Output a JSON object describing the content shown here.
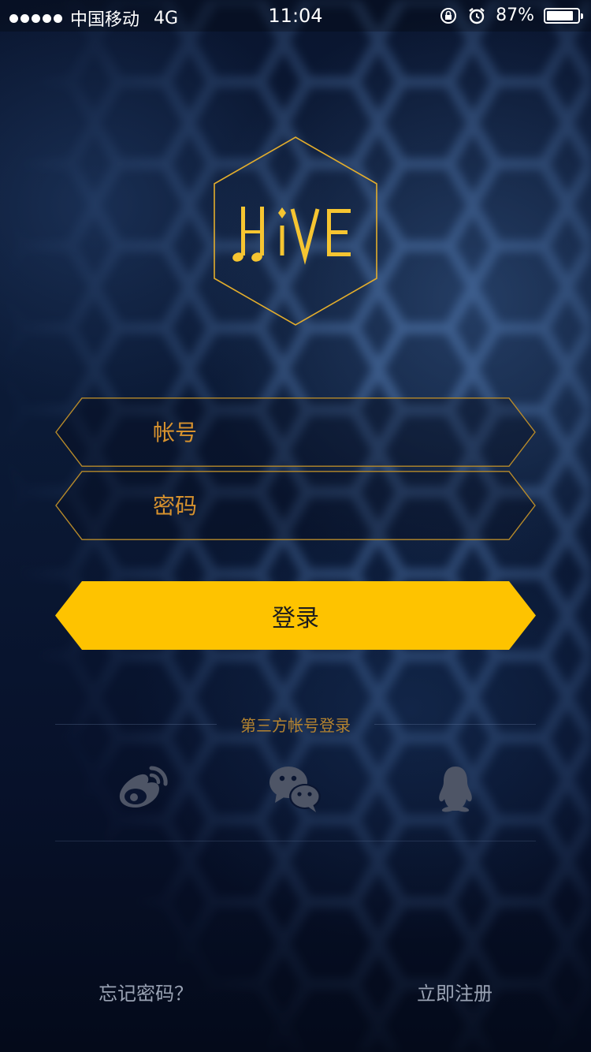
{
  "status_bar": {
    "carrier": "中国移动",
    "network": "4G",
    "time": "11:04",
    "battery_percent": "87%",
    "battery_level": 0.87
  },
  "logo": {
    "text_h": "H",
    "text_i": "i",
    "text_ve": "VE",
    "color": "#f6c531"
  },
  "login_form": {
    "account_placeholder": "帐号",
    "password_placeholder": "密码",
    "login_button_label": "登录"
  },
  "third_party": {
    "title": "第三方帐号登录",
    "icons": [
      "weibo-icon",
      "wechat-icon",
      "qq-icon"
    ]
  },
  "footer": {
    "forgot_password": "忘记密码？",
    "register": "立即注册"
  },
  "colors": {
    "accent": "#fec300",
    "border_gold": "#b78a2a",
    "icon_gray": "#4e5566"
  }
}
